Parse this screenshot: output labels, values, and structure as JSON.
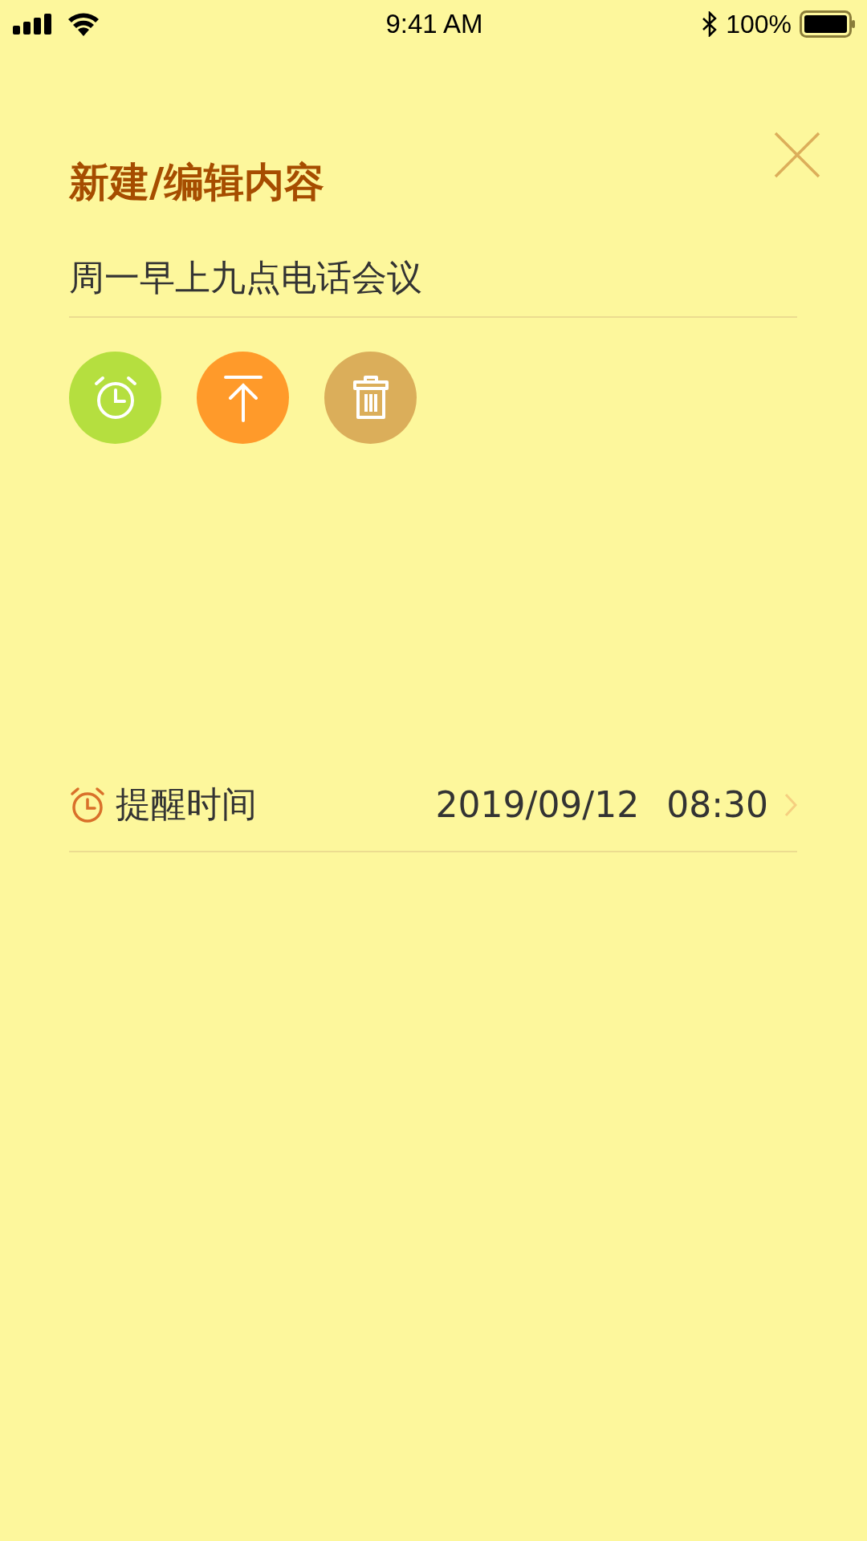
{
  "status_bar": {
    "time": "9:41 AM",
    "battery": "100%"
  },
  "title": "新建/编辑内容",
  "content": {
    "value": "周一早上九点电话会议"
  },
  "actions": [
    {
      "kind": "alarm",
      "color": "#b5df3f"
    },
    {
      "kind": "pin-top",
      "color": "#ff9a2a"
    },
    {
      "kind": "delete",
      "color": "#dbae5a"
    }
  ],
  "reminder": {
    "label": "提醒时间",
    "date": "2019/09/12",
    "time": "08:30"
  }
}
